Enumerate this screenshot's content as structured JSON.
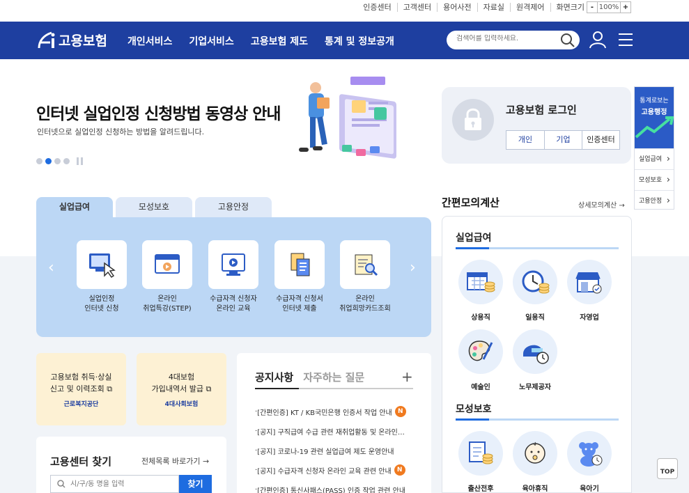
{
  "util": {
    "links": [
      "인증센터",
      "고객센터",
      "용어사전",
      "자료실",
      "원격제어",
      "화면크기"
    ],
    "zoom_minus": "-",
    "zoom_value": "100%",
    "zoom_plus": "+"
  },
  "header": {
    "logo_text": "고용보험",
    "nav": [
      "개인서비스",
      "기업서비스",
      "고용보험 제도",
      "통계 및 정보공개"
    ],
    "search_placeholder": "검색어를 입력하세요."
  },
  "hero": {
    "title": "인터넷 실업인정 신청방법 동영상 안내",
    "subtitle": "인터넷으로 실업인정 신청하는 방법을 알려드립니다.",
    "active_slide": 2,
    "slide_count": 4
  },
  "login": {
    "title": "고용보험 로그인",
    "buttons": [
      "개인",
      "기업",
      "인증센터"
    ]
  },
  "quick": {
    "top_line1": "통계로보는",
    "top_line2": "고용행정",
    "items": [
      "실업급여",
      "모성보호",
      "고용안정"
    ]
  },
  "tabs": [
    "실업급여",
    "모성보호",
    "고용안정"
  ],
  "services": [
    {
      "line1": "실업인정",
      "line2": "인터넷 신청",
      "icon": "monitor-click-icon"
    },
    {
      "line1": "온라인",
      "line2": "취업특강(STEP)",
      "icon": "browser-icon"
    },
    {
      "line1": "수급자격 신청자",
      "line2": "온라인 교육",
      "icon": "video-monitor-icon"
    },
    {
      "line1": "수급자격 신청서",
      "line2": "인터넷 제출",
      "icon": "documents-icon"
    },
    {
      "line1": "온라인",
      "line2": "취업희망카드조회",
      "icon": "card-search-icon"
    }
  ],
  "ycards": [
    {
      "line1": "고용보험 취득·상실",
      "line2": "신고 및 이력조회",
      "org": "근로복지공단"
    },
    {
      "line1": "4대보험",
      "line2": "가입내역서 발급",
      "org": "4대사회보험"
    }
  ],
  "notice": {
    "tabs": [
      "공지사항",
      "자주하는 질문"
    ],
    "plus": "+",
    "items": [
      {
        "text": "[간편인증] KT / KB국민은행 인증서 작업 안내",
        "badge": "N"
      },
      {
        "text": "[공지] 구직급여 수급 관련 재취업활동 및 온라인 안내",
        "badge": ""
      },
      {
        "text": "[공지] 코로나-19 관련 실업급여 제도 운영안내",
        "badge": ""
      },
      {
        "text": "[공지] 수급자격 신청자 온라인 교육 관련 안내",
        "badge": "N"
      },
      {
        "text": "[간편인증] 통신사패스(PASS) 인증 작업 관련 안내",
        "badge": ""
      }
    ]
  },
  "find": {
    "title": "고용센터 찾기",
    "link": "전체목록 바로가기",
    "placeholder": "시/구/동 명을 입력",
    "button": "찾기"
  },
  "calc": {
    "title": "간편모의계산",
    "link": "상세모의계산",
    "sections": [
      {
        "title": "실업급여",
        "items": [
          "상용직",
          "일용직",
          "자영업",
          "예술인",
          "노무제공자"
        ]
      },
      {
        "title": "모성보호",
        "items": [
          "출산전후",
          "육아휴직",
          "육아기"
        ]
      }
    ]
  },
  "top_button": "TOP",
  "colors": {
    "primary": "#1e3fa0",
    "accent": "#1e6ce0",
    "panel": "#bcd7f5",
    "badge": "#f07a1f",
    "card": "#fdf1d4"
  }
}
